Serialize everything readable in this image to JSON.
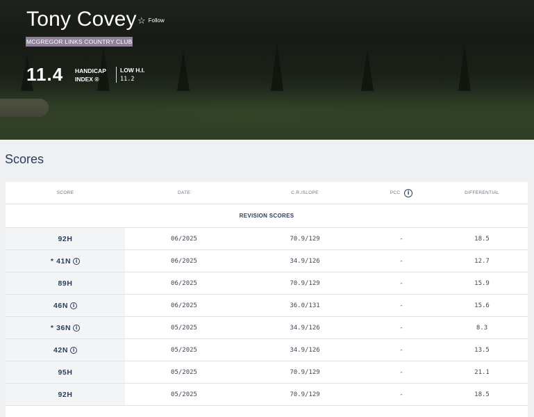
{
  "profile": {
    "name": "Tony Covey",
    "follow_label": "Follow",
    "follow_icon": "star-outline-icon",
    "club": "MCGREGOR LINKS COUNTRY CLUB",
    "handicap_index": "11.4",
    "handicap_label_line1": "HANDICAP",
    "handicap_label_line2": "INDEX ®",
    "low_hi_label": "LOW H.I.",
    "low_hi_value": "11.2"
  },
  "scores": {
    "title": "Scores",
    "columns": {
      "score": "SCORE",
      "date": "DATE",
      "cr_slope": "C.R./SLOPE",
      "pcc": "PCC",
      "differential": "DIFFERENTIAL"
    },
    "section_label": "REVISION SCORES",
    "rows": [
      {
        "score": "92H",
        "info": false,
        "date": "06/2025",
        "cr_slope": "70.9/129",
        "pcc": "-",
        "differential": "18.5"
      },
      {
        "score": "* 41N",
        "info": true,
        "date": "06/2025",
        "cr_slope": "34.9/126",
        "pcc": "-",
        "differential": "12.7"
      },
      {
        "score": "89H",
        "info": false,
        "date": "06/2025",
        "cr_slope": "70.9/129",
        "pcc": "-",
        "differential": "15.9"
      },
      {
        "score": "46N",
        "info": true,
        "date": "06/2025",
        "cr_slope": "36.0/131",
        "pcc": "-",
        "differential": "15.6"
      },
      {
        "score": "* 36N",
        "info": true,
        "date": "05/2025",
        "cr_slope": "34.9/126",
        "pcc": "-",
        "differential": "8.3"
      },
      {
        "score": "42N",
        "info": true,
        "date": "05/2025",
        "cr_slope": "34.9/126",
        "pcc": "-",
        "differential": "13.5"
      },
      {
        "score": "95H",
        "info": false,
        "date": "05/2025",
        "cr_slope": "70.9/129",
        "pcc": "-",
        "differential": "21.1"
      },
      {
        "score": "92H",
        "info": false,
        "date": "05/2025",
        "cr_slope": "70.9/129",
        "pcc": "-",
        "differential": "18.5"
      }
    ]
  },
  "colors": {
    "accent": "#2a3d5c",
    "club_highlight": "#8f8199",
    "page_bg": "#eef0f2"
  }
}
